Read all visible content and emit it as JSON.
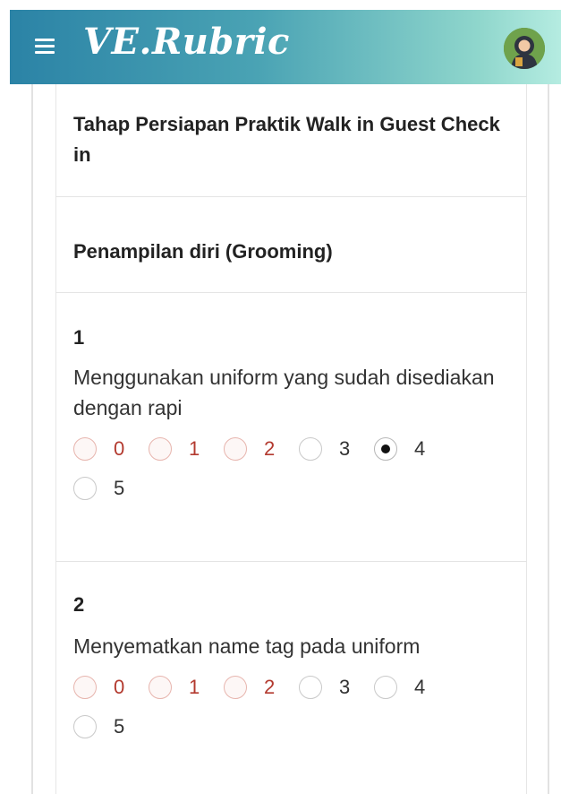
{
  "header": {
    "title": "VE.Rubric",
    "menu_icon": "hamburger-menu-icon",
    "avatar_icon": "user-avatar-hijab"
  },
  "sections": {
    "stage_title": "Tahap Persiapan Praktik Walk in Guest Check in",
    "group_title": "Penampilan diri (Grooming)"
  },
  "questions": [
    {
      "number": "1",
      "text": "Menggunakan uniform yang sudah disediakan dengan rapi",
      "options": [
        "0",
        "1",
        "2",
        "3",
        "4",
        "5"
      ],
      "selected": "4"
    },
    {
      "number": "2",
      "text": "Menyematkan name tag pada uniform",
      "options": [
        "0",
        "1",
        "2",
        "3",
        "4",
        "5"
      ],
      "selected": null
    }
  ],
  "colors": {
    "header_start": "#2b83a6",
    "header_end": "#b5ece1",
    "low_score": "#b33a2f"
  }
}
